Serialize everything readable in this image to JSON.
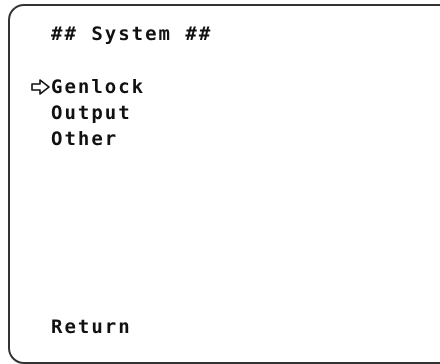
{
  "menu": {
    "title": "## System ##",
    "cursor_icon": "pointing-arrow-icon",
    "selected_index": 0,
    "items": [
      {
        "label": "Genlock"
      },
      {
        "label": "Output"
      },
      {
        "label": "Other"
      }
    ],
    "return_label": "Return"
  },
  "colors": {
    "text": "#111111",
    "background": "#ffffff",
    "frame": "#333333"
  }
}
